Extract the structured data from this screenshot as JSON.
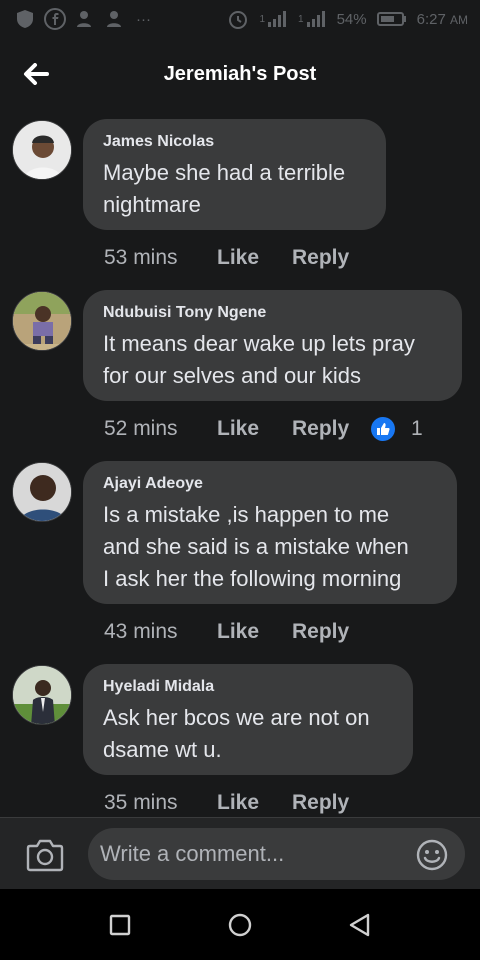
{
  "status_bar": {
    "battery": "54%",
    "time": "6:27",
    "ampm": "AM",
    "dots": "···",
    "net1": "1",
    "net2": "1"
  },
  "header": {
    "title": "Jeremiah's Post"
  },
  "comments": [
    {
      "author": "James Nicolas",
      "lines": [
        "Maybe she had a terrible",
        "nightmare"
      ],
      "time": "53 mins",
      "like": "Like",
      "reply": "Reply"
    },
    {
      "author": "Ndubuisi Tony Ngene",
      "lines": [
        "It means dear wake up lets pray",
        "for our selves and our kids"
      ],
      "time": "52 mins",
      "like": "Like",
      "reply": "Reply",
      "reactions": "1"
    },
    {
      "author": "Ajayi Adeoye",
      "lines": [
        "Is a mistake ,is happen to me",
        "and she said is a mistake when",
        "I ask her the following morning"
      ],
      "time": "43 mins",
      "like": "Like",
      "reply": "Reply"
    },
    {
      "author": "Hyeladi Midala",
      "lines": [
        "Ask her bcos we are not on",
        "dsame wt u."
      ],
      "time": "35 mins",
      "like": "Like",
      "reply": "Reply"
    }
  ],
  "composer": {
    "placeholder": "Write a comment..."
  },
  "colors": {
    "background": "#18191a",
    "bubble": "#3a3b3c",
    "like_badge": "#1877f2"
  }
}
